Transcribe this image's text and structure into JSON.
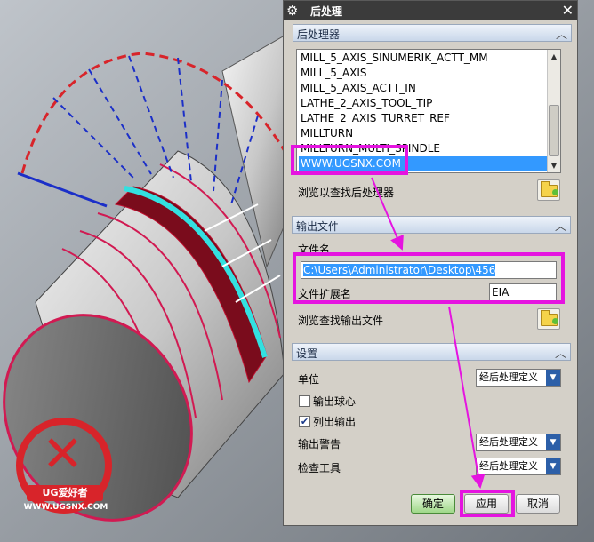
{
  "dialog": {
    "title": "后处理",
    "sections": {
      "postprocessor": "后处理器",
      "output_file": "输出文件",
      "settings": "设置"
    },
    "postprocessor_list": {
      "items": [
        "MILL_5_AXIS_SINUMERIK_ACTT_MM",
        "MILL_5_AXIS",
        "MILL_5_AXIS_ACTT_IN",
        "LATHE_2_AXIS_TOOL_TIP",
        "LATHE_2_AXIS_TURRET_REF",
        "MILLTURN",
        "MILLTURN_MULTI_SPINDLE",
        "WWW.UGSNX.COM"
      ],
      "selected": "WWW.UGSNX.COM"
    },
    "browse_post_label": "浏览以查找后处理器",
    "filename_label": "文件名",
    "filename_value": "C:\\Users\\Administrator\\Desktop\\456",
    "extension_label": "文件扩展名",
    "extension_value": "EIA",
    "browse_output_label": "浏览查找输出文件",
    "units_label": "单位",
    "units_value": "经后处理定义",
    "output_ball_center_label": "输出球心",
    "output_ball_center_checked": false,
    "list_output_label": "列出输出",
    "list_output_checked": true,
    "output_warning_label": "输出警告",
    "output_warning_value": "经后处理定义",
    "check_tool_label": "检查工具",
    "check_tool_value": "经后处理定义",
    "buttons": {
      "ok": "确定",
      "apply": "应用",
      "cancel": "取消"
    }
  },
  "watermark": {
    "brand": "UG爱好者",
    "url": "WWW.UGSNX.COM"
  },
  "colors": {
    "highlight": "#e514e0",
    "selection": "#3399ff",
    "logo_red": "#d8242a"
  }
}
